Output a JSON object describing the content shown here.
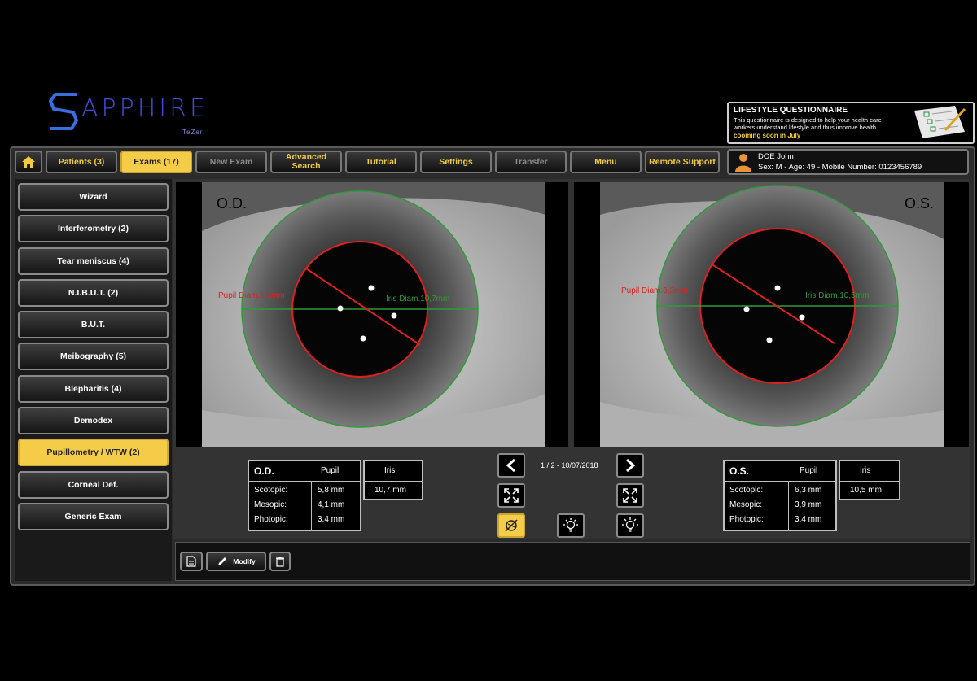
{
  "logo": {
    "word": "APPHIRE",
    "sub": "TeZer"
  },
  "questionnaire": {
    "title": "LIFESTYLE QUESTIONNAIRE",
    "desc": "This questionnaire is designed to help your health care workers understand lifestyle and thus improve health.",
    "soon": "cooming soon in July"
  },
  "nav": {
    "patients": "Patients (3)",
    "exams": "Exams (17)",
    "new_exam": "New Exam",
    "advanced_search": "Advanced Search",
    "tutorial": "Tutorial",
    "settings": "Settings",
    "transfer": "Transfer",
    "menu": "Menu",
    "remote_support": "Remote Support"
  },
  "patient": {
    "name": "DOE John",
    "info": "Sex: M - Age: 49 - Mobile Number: 0123456789"
  },
  "sidebar": {
    "items": [
      {
        "label": "Wizard"
      },
      {
        "label": "Interferometry (2)"
      },
      {
        "label": "Tear meniscus (4)"
      },
      {
        "label": "N.I.B.U.T. (2)"
      },
      {
        "label": "B.U.T."
      },
      {
        "label": "Meibography (5)"
      },
      {
        "label": "Blepharitis (4)"
      },
      {
        "label": "Demodex"
      },
      {
        "label": "Pupillometry / WTW (2)"
      },
      {
        "label": "Corneal Def."
      },
      {
        "label": "Generic Exam"
      }
    ]
  },
  "od": {
    "label": "O.D.",
    "pupil_diam": "Pupil Diam.5,8mm",
    "iris_diam": "Iris Diam.10,7mm",
    "table": {
      "title": "O.D.",
      "pupil_header": "Pupil",
      "iris_header": "Iris",
      "iris_value": "10,7 mm",
      "rows": [
        {
          "label": "Scotopic:",
          "value": "5,8 mm"
        },
        {
          "label": "Mesopic:",
          "value": "4,1 mm"
        },
        {
          "label": "Photopic:",
          "value": "3,4 mm"
        }
      ]
    }
  },
  "os": {
    "label": "O.S.",
    "pupil_diam": "Pupil Diam.6,3mm",
    "iris_diam": "Iris Diam.10,5mm",
    "table": {
      "title": "O.S.",
      "pupil_header": "Pupil",
      "iris_header": "Iris",
      "iris_value": "10,5 mm",
      "rows": [
        {
          "label": "Scotopic:",
          "value": "6,3 mm"
        },
        {
          "label": "Mesopic:",
          "value": "3,9 mm"
        },
        {
          "label": "Photopic:",
          "value": "3,4 mm"
        }
      ]
    }
  },
  "pager": {
    "text": "1 / 2 - 10/07/2018"
  },
  "toolbar": {
    "modify": "Modify"
  },
  "colors": {
    "accent": "#f5cc48",
    "pupil": "#e02020",
    "iris": "#2f9a3a"
  }
}
